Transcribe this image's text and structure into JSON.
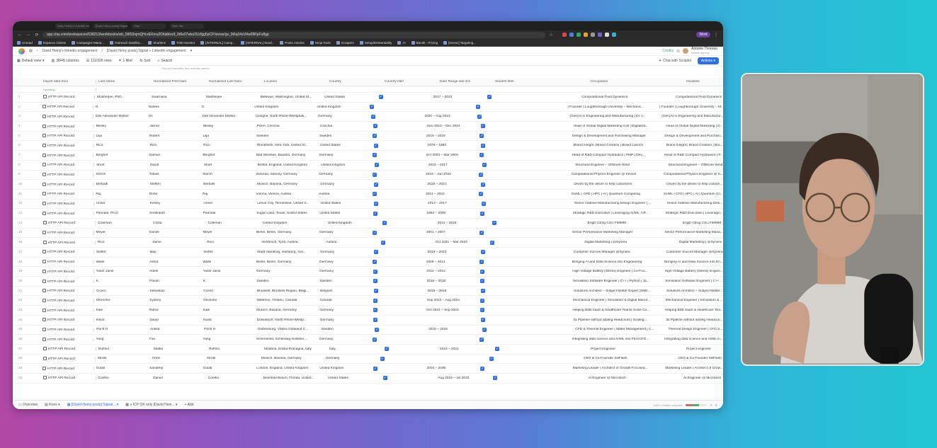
{
  "browser": {
    "tabs": [
      "Daily Heiny's LinkedIn engag...",
      "[Daily Heiny posts] Signal...",
      "Clay",
      "New Tab"
    ],
    "url": "app.clay.com/workspaces/538213/workbooks/wb_0t653ojmQHcxEKmu2D/tables/t_0t6e07wks2Ucfgg5pCP/views/gv_0t6q34zU4w08RpFu8gp",
    "work_label": "Work",
    "bookmarks": [
      "Unread",
      "Espaces Clients",
      "Campaigns Mana...",
      "Outreach Dashbo...",
      "Sharlens",
      "TOB Investor",
      "[INTERNAL] Camp...",
      "[INTERNAL] Send...",
      "Posts Antoine",
      "Ninja Tools",
      "Scrapers",
      "Setup/Deliverability",
      "AI",
      "Bandit - Pricing",
      "[Invesv] Targeting..."
    ]
  },
  "app": {
    "breadcrumb": [
      "David Heiny's linkedin engagement",
      "[David Heiny posts] Signal + Linkedin engagement"
    ],
    "credits_label": "Credits",
    "user_name": "Antoine Thoreau",
    "user_org": "Bandit Agency"
  },
  "toolbar": {
    "view": "Default view",
    "columns": "38/45 columns",
    "rows": "111/326 rows",
    "filter": "1 filter",
    "sort": "Sort",
    "search": "Search",
    "chat": "Chat with Sculptor",
    "actions": "Actions"
  },
  "subnote": "Overall Normalize first and last names",
  "columns": [
    "Import data from",
    "Last Name",
    "Normalized First Nam",
    "Normalized Last Nam",
    "Location",
    "Country",
    "Country filter",
    "Date Range last sch",
    "Student filter",
    "Occupation",
    "Headline"
  ],
  "subrow": [
    "Updating...",
    "",
    "",
    "",
    "",
    "",
    "",
    "",
    "",
    "",
    ""
  ],
  "rows": [
    [
      "HTTP API Record",
      "Mukherjee, PhD",
      "Swarnava",
      "Mukherjee",
      "Bellevue, Washington, United St...",
      "United States",
      "",
      "2017 – 2023",
      "",
      "Computational Fluid Dynamics",
      "Computational Fluid Dynamics"
    ],
    [
      "HTTP API Record",
      "G.",
      "Nafees",
      "G.",
      "United Kingdom",
      "United Kingdom",
      "",
      "",
      "",
      "| Founder | Loughborough University – Mechanic...",
      "| Founder | Loughborough University – M..."
    ],
    [
      "HTTP API Record",
      "Dirk Alexander Molitor",
      "Dr.",
      "Dirk Alexander Molitor",
      "Cologne, North Rhine-Westphali...",
      "Germany",
      "",
      "2020 – Aug 2023",
      "",
      "(Gen)AI in Engineering and Manufacturing | Dr.-I...",
      "(Gen)AI in Engineering and Manufactur..."
    ],
    [
      "HTTP API Record",
      "Bleiley",
      "Jarrod",
      "Bleiley",
      "Plzeň, Czechia",
      "Czechia",
      "",
      "Nov 2023 – Dec 2024",
      "",
      "Head of Global Digital Marketing Coll | Digitaliza...",
      "Head of Global Digital Marketing | D..."
    ],
    [
      "HTTP API Record",
      "Lilja",
      "Robert",
      "Lilja",
      "Sweden",
      "Sweden",
      "",
      "2018 – 2018",
      "",
      "Design & Development and Purchasing Manager",
      "Design & Development and Purchasi..."
    ],
    [
      "HTTP API Record",
      "Rico",
      "Rich",
      "Rico",
      "Rhinebeck, New York, United St...",
      "United States",
      "",
      "1978 – 1982",
      "",
      "Brand Insight | Brand Creation | Brand Launch",
      "Brand Insight | Brand Creation | Bra..."
    ],
    [
      "HTTP API Record",
      "Berghof",
      "Daman",
      "Berghof",
      "Bad Wiessee, Bavaria, Germany",
      "Germany",
      "",
      "Oct 2003 – Mar 2009",
      "",
      "Head of R&D Compact Hydraulics | PMP | Driv...",
      "Head of R&D Compact Hydraulics | P..."
    ],
    [
      "HTTP API Record",
      "Short",
      "David",
      "Short",
      "Bristol, England, United Kingdom",
      "United Kingdom",
      "",
      "2015 – 2017",
      "",
      "Structural Engineer – Offshore Wind",
      "Structural Engineer – Offshore Wind"
    ],
    [
      "HTTP API Record",
      "Storch",
      "Tobias",
      "Storch",
      "Zwickau, Saxony, Germany",
      "Germany",
      "",
      "2016 – Jun 2022",
      "",
      "Computational Physics Engineer @ Kevion",
      "Computational Physics Engineer @ K..."
    ],
    [
      "HTTP API Record",
      "Berbalk",
      "Steffen",
      "Berbalk",
      "Munich, Bavaria, Germany",
      "Germany",
      "",
      "2018 – 2021",
      "",
      "Driven by the desire to help customers",
      "Driven by the desire to help custom..."
    ],
    [
      "HTTP API Record",
      "Raj",
      "Rohit",
      "Raj",
      "Vienna, Vienna, Austria",
      "Austria",
      "",
      "2021 – 2022",
      "",
      "SciML | CFD | HPC | AI | Quantum Computing",
      "SciML | CFD | HPC | AI | Quantum Co..."
    ],
    [
      "HTTP API Record",
      "Unser",
      "Kelsey",
      "Unser",
      "Lenoir City, Tennessee, United S...",
      "United States",
      "",
      "2013 – 2017",
      "",
      "Senior Additive Manufacturing Design Engineer | ...",
      "Senior Additive Manufacturing Desi..."
    ],
    [
      "HTTP API Record",
      "Pannala, Ph.D.",
      "Sreekanth",
      "Pannala",
      "Sugar Land, Texas, United States",
      "United States",
      "",
      "1984 – 2000",
      "",
      "Strategic R&D Executive | Leveraging AI/ML, HP...",
      "Strategic R&D Executive | Leveragin..."
    ],
    [
      "HTTP API Record",
      "Coleman",
      "Costa",
      "Coleman",
      "United Kingdom",
      "United Kingdom",
      "",
      "2012 – 2016",
      "",
      "EngD CEng CSci FIMMM",
      "EngD CEng CSci FIMMM"
    ],
    [
      "HTTP API Record",
      "Meyer",
      "Daniel",
      "Meyer",
      "Berlin, Berlin, Germany",
      "Germany",
      "",
      "2001 – 2007",
      "",
      "Senior Performance Marketing Manager",
      "Senior Performance Marketing Mana..."
    ],
    [
      "HTTP API Record",
      "Rico",
      "Jaime",
      "Rico",
      "Innsbruck, Tyrol, Austria",
      "Austria",
      "",
      "Oct 2021 – Mar 2023",
      "",
      "Digital Marketing | @Synera",
      "Digital Marketing | @Synera"
    ],
    [
      "HTTP API Record",
      "Seiffer",
      "Max",
      "Seiffer",
      "Stadt Hamburg, Hamburg, Ger...",
      "Germany",
      "",
      "2019 – 2023",
      "",
      "Customer Succes Manager @Synera",
      "Customer Succes Manager @Synera"
    ],
    [
      "HTTP API Record",
      "Walle",
      "Astrid",
      "Walle",
      "Berlin, Berlin, Germany",
      "Germany",
      "",
      "2009 – 2014",
      "",
      "Bringing AI and Data Science into Engineering",
      "Bringing AI and Data Science into En..."
    ],
    [
      "HTTP API Record",
      "Yaser Jamil",
      "Adeel",
      "Yaser Jamil",
      "Germany",
      "Germany",
      "",
      "2012 – 2014",
      "",
      "High Voltage Battery (Stress) Engineer | Co-Fou...",
      "High Voltage Battery (Stress) Engine..."
    ],
    [
      "HTTP API Record",
      "K.",
      "Pavan",
      "K.",
      "Sweden",
      "Sweden",
      "",
      "2016 – 2018",
      "",
      "Simulation Software Engineer | C++ | Python | Ja...",
      "Simulation Software Engineer | C++ ..."
    ],
    [
      "HTTP API Record",
      "Cicero",
      "Sebastian",
      "Cicero",
      "Brussels, Brussels Region, Belgi...",
      "Belgium",
      "",
      "2016 – 2018",
      "",
      "Solutions Architect – Subject Matter Expert (SME...",
      "Solutions Architect – Subject Matter..."
    ],
    [
      "HTTP API Record",
      "Okonofor",
      "Sydney",
      "Okonofor",
      "Waterloo, Ontario, Canada",
      "Canada",
      "",
      "Sep 2022 – Aug 2024",
      "",
      "Mechanical Engineer | Simulation & Digital Manuf...",
      "Mechanical Engineer | Simulation & ..."
    ],
    [
      "HTTP API Record",
      "Kale",
      "Rahul",
      "Kale",
      "Munich, Bavaria, Germany",
      "Germany",
      "",
      "Oct 2021 – Sep 2023",
      "",
      "Helping B2B SaaS & Healthcare Teams Solve Co...",
      "Helping B2B SaaS & Healthcare Tea..."
    ],
    [
      "HTTP API Record",
      "Kwirit",
      "David",
      "Kwirit",
      "Düsseldorf, North Rhine-Westp...",
      "Germany",
      "",
      "",
      "",
      "3x Pipeline without adding Headcount | Scaling ...",
      "3x Pipeline without adding Headcou..."
    ],
    [
      "HTTP API Record",
      "Pal B H",
      "Ankita",
      "Pal B H",
      "Gothenburg, Västra Götaland C...",
      "Sweden",
      "",
      "2016 – 2018",
      "",
      "CFD & Thermal Engineer | Water Management | C...",
      "Thermal Design Engineer | CFD S..."
    ],
    [
      "HTTP API Record",
      "Yang",
      "Fan",
      "Yang",
      "Schenefeld, Schleswig-Holstein,...",
      "Germany",
      "",
      "",
      "",
      "Integrating data science and AI/ML into FEA/CFD...",
      "Integrating data science and AI/ML in..."
    ],
    [
      "HTTP API Record",
      "Ruffino",
      "Mattia",
      "Ruffino",
      "Modena, Emilia-Romagna, Italy",
      "Italy",
      "",
      "2016 – 2021",
      "",
      "Project engineer",
      "Project engineer"
    ],
    [
      "HTTP API Record",
      "Strobl",
      "Chris",
      "Strobl",
      "Munich, Bavaria, Germany",
      "Germany",
      "",
      "",
      "",
      "CEO & Co-Founder SiliFlash",
      "CEO & Co-Founder SiliFlash"
    ],
    [
      "HTTP API Record",
      "Gulati",
      "Sandeep",
      "Gulati",
      "London, England, United Kingdom",
      "United Kingdom",
      "",
      "2004 – 2006",
      "",
      "Marketing Leader | Architect of Growth-Focused...",
      "Marketing Leader | Architect of Grow..."
    ],
    [
      "HTTP API Record",
      "Coelho",
      "Daniel",
      "Coelho",
      "Deerfield Beach, Florida, United...",
      "United States",
      "",
      "Aug 2022 – Jul 2023",
      "",
      "AI Engineer @ Microtech",
      "AI Engineer @ Microtech"
    ]
  ],
  "footer": {
    "overview": "Overview",
    "runs": "Runs",
    "tab_active": "[David Heiny posts] Signal...",
    "tab2": "ICP OK only [David Hein...",
    "add": "+ Add",
    "progress_label": "100% of table complete",
    "progress_fraction": 0.62
  },
  "colors": {
    "accent": "#2f6fe4",
    "work_badge": "#6b3fa0"
  }
}
